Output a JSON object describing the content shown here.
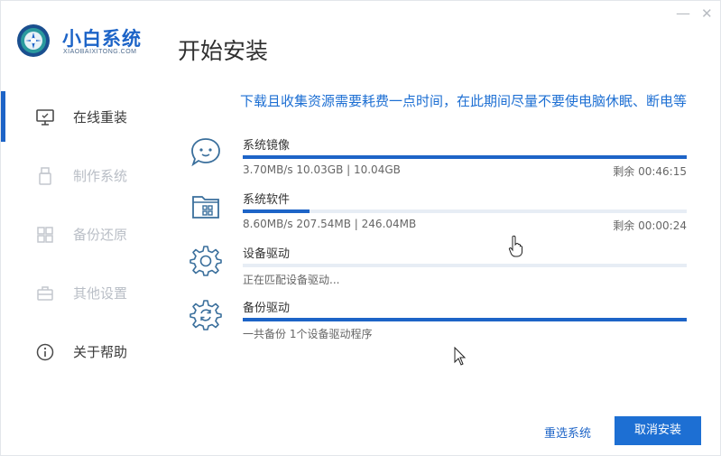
{
  "window": {
    "minimize_glyph": "—",
    "close_glyph": "✕"
  },
  "logo": {
    "title": "小白系统",
    "subtitle": "XIAOBAIXITONG.COM"
  },
  "page_title": "开始安装",
  "sidebar": {
    "items": [
      {
        "label": "在线重装",
        "icon": "monitor-icon"
      },
      {
        "label": "制作系统",
        "icon": "usb-icon"
      },
      {
        "label": "备份还原",
        "icon": "grid-icon"
      },
      {
        "label": "其他设置",
        "icon": "briefcase-icon"
      },
      {
        "label": "关于帮助",
        "icon": "info-icon"
      }
    ]
  },
  "notice": "下载且收集资源需要耗费一点时间，在此期间尽量不要使电脑休眠、断电等",
  "tasks": [
    {
      "name": "系统镜像",
      "detail": "3.70MB/s 10.03GB | 10.04GB",
      "remaining": "剩余 00:46:15",
      "progress": 0.999,
      "icon": "chat-bubble-icon"
    },
    {
      "name": "系统软件",
      "detail": "8.60MB/s 207.54MB | 246.04MB",
      "remaining": "剩余 00:00:24",
      "progress": 0.15,
      "icon": "folder-apps-icon"
    },
    {
      "name": "设备驱动",
      "detail": "正在匹配设备驱动...",
      "remaining": "",
      "progress": 0.0,
      "icon": "gear-icon"
    },
    {
      "name": "备份驱动",
      "detail": "一共备份 1个设备驱动程序",
      "remaining": "",
      "progress": 1.0,
      "icon": "gear-refresh-icon"
    }
  ],
  "buttons": {
    "reselect": "重选系统",
    "cancel": "取消安装"
  },
  "colors": {
    "accent": "#1d64c7",
    "link": "#1d6fd3",
    "track": "#e7edf5",
    "inactive": "#b9bec6"
  }
}
